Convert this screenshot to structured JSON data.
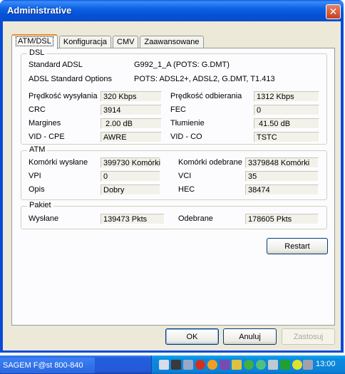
{
  "window": {
    "title": "Administrative",
    "close_glyph": "✕"
  },
  "tabs": [
    "ATM/DSL",
    "Konfiguracja",
    "CMV",
    "Zaawansowane"
  ],
  "active_tab": "ATM/DSL",
  "dsl": {
    "label": "DSL",
    "standard_adsl_label": "Standard ADSL",
    "standard_adsl_value": "G992_1_A (POTS: G.DMT)",
    "adsl_options_label": "ADSL Standard Options",
    "adsl_options_value": "POTS: ADSL2+, ADSL2, G.DMT, T1.413",
    "upload_label": "Prędkość wysyłania",
    "upload_value": "320 Kbps",
    "download_label": "Prędkość odbierania",
    "download_value": "1312 Kbps",
    "crc_label": "CRC",
    "crc_value": "3914",
    "fec_label": "FEC",
    "fec_value": "0",
    "margins_label": "Margines",
    "margins_value": "2.00 dB",
    "attenuation_label": "Tłumienie",
    "attenuation_value": "41.50 dB",
    "vid_cpe_label": "VID - CPE",
    "vid_cpe_value": "AWRE",
    "vid_co_label": "VID - CO",
    "vid_co_value": "TSTC"
  },
  "atm": {
    "label": "ATM",
    "cells_sent_label": "Komórki wysłane",
    "cells_sent_value": "399730 Komórki",
    "cells_received_label": "Komórki odebrane",
    "cells_received_value": "3379848 Komórki",
    "vpi_label": "VPI",
    "vpi_value": "0",
    "vci_label": "VCI",
    "vci_value": "35",
    "desc_label": "Opis",
    "desc_value": "Dobry",
    "hec_label": "HEC",
    "hec_value": "38474"
  },
  "packet": {
    "label": "Pakiet",
    "sent_label": "Wysłane",
    "sent_value": "139473 Pkts",
    "received_label": "Odebrane",
    "received_value": "178605 Pkts"
  },
  "buttons": {
    "restart": "Restart",
    "ok": "OK",
    "cancel": "Anuluj",
    "apply": "Zastosuj"
  },
  "taskbar": {
    "task_label": "SAGEM F@st 800-840",
    "clock": "13:00",
    "tray_icons": [
      "monitor-icon",
      "k-icon",
      "network-icon",
      "shield-icon",
      "sun-icon",
      "grid-icon",
      "mail-icon",
      "user-icon",
      "globe-icon",
      "speaker-icon",
      "play-icon",
      "refresh-icon",
      "volume-icon",
      "network-icon-2",
      "firewall-icon"
    ]
  },
  "colors": {
    "title_bar": "#0a4ad8",
    "close_button": "#d4552f",
    "tab_highlight": "#e68b2c",
    "dialog_bg": "#ece9d8",
    "taskbar": "#245edc"
  }
}
